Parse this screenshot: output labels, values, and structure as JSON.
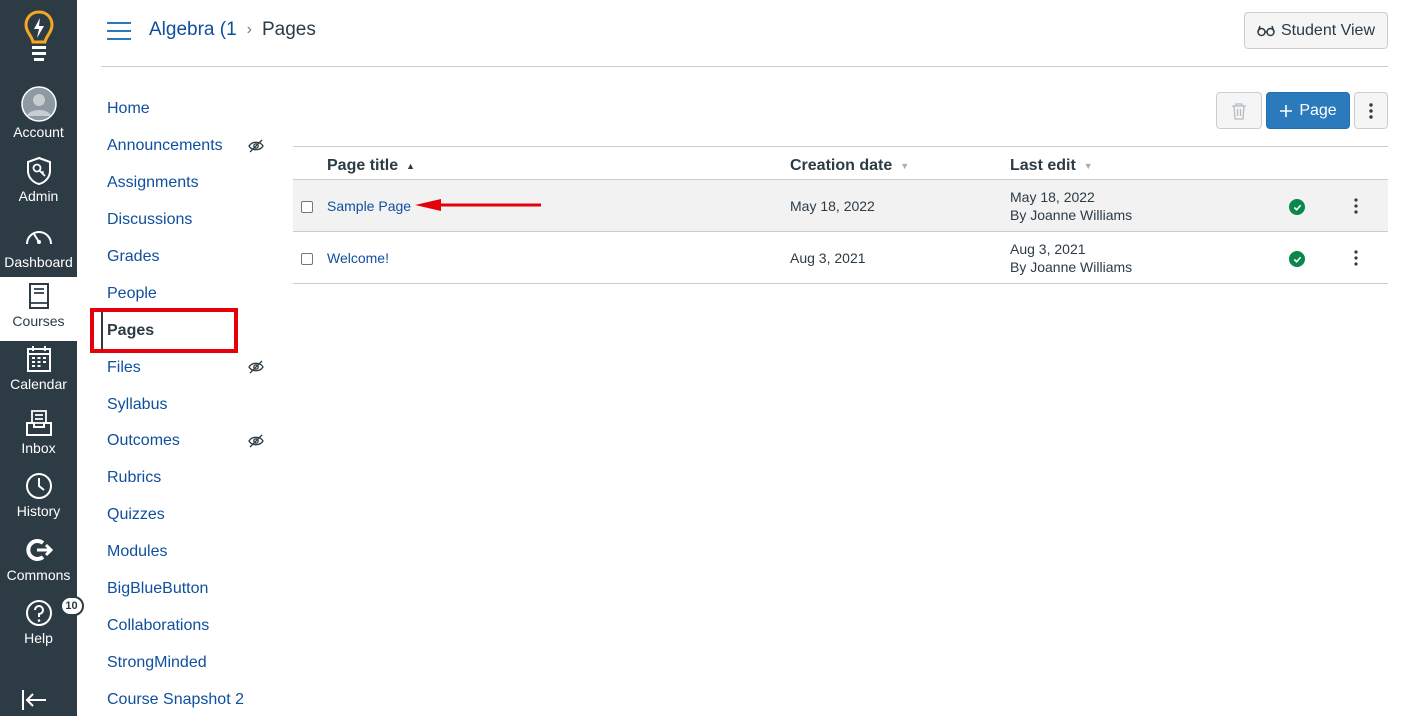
{
  "global_nav": {
    "items": [
      {
        "label": "Account",
        "icon": "user-avatar-icon"
      },
      {
        "label": "Admin",
        "icon": "shield-icon"
      },
      {
        "label": "Dashboard",
        "icon": "speedometer-icon"
      },
      {
        "label": "Courses",
        "icon": "book-icon"
      },
      {
        "label": "Calendar",
        "icon": "calendar-icon"
      },
      {
        "label": "Inbox",
        "icon": "inbox-icon"
      },
      {
        "label": "History",
        "icon": "clock-icon"
      },
      {
        "label": "Commons",
        "icon": "commons-icon"
      },
      {
        "label": "Help",
        "icon": "help-icon",
        "badge": "10"
      }
    ],
    "active": "Courses",
    "colors": {
      "background": "#2d3b45",
      "logo_accent": "#f5a623"
    }
  },
  "header": {
    "breadcrumb_course": "Algebra (1",
    "breadcrumb_sep": "›",
    "breadcrumb_current": "Pages",
    "student_view_label": "Student View"
  },
  "course_nav": {
    "items": [
      {
        "label": "Home"
      },
      {
        "label": "Announcements",
        "hidden": true
      },
      {
        "label": "Assignments"
      },
      {
        "label": "Discussions"
      },
      {
        "label": "Grades"
      },
      {
        "label": "People"
      },
      {
        "label": "Pages",
        "active": true
      },
      {
        "label": "Files",
        "hidden": true
      },
      {
        "label": "Syllabus"
      },
      {
        "label": "Outcomes",
        "hidden": true
      },
      {
        "label": "Rubrics"
      },
      {
        "label": "Quizzes"
      },
      {
        "label": "Modules"
      },
      {
        "label": "BigBlueButton"
      },
      {
        "label": "Collaborations"
      },
      {
        "label": "StrongMinded"
      },
      {
        "label": "Course Snapshot 2"
      }
    ]
  },
  "toolbar": {
    "add_page_label": "Page"
  },
  "table": {
    "headers": {
      "title": "Page title",
      "created": "Creation date",
      "edited": "Last edit"
    },
    "rows": [
      {
        "title": "Sample Page",
        "created": "May 18, 2022",
        "edited": "May 18, 2022",
        "edited_by": "By Joanne Williams",
        "published": true
      },
      {
        "title": "Welcome!",
        "created": "Aug 3, 2021",
        "edited": "Aug 3, 2021",
        "edited_by": "By Joanne Williams",
        "published": true
      }
    ]
  },
  "colors": {
    "link": "#0e4f9e",
    "primary_button": "#2b7abc",
    "published": "#0b874b",
    "annotation": "#e5000b"
  }
}
